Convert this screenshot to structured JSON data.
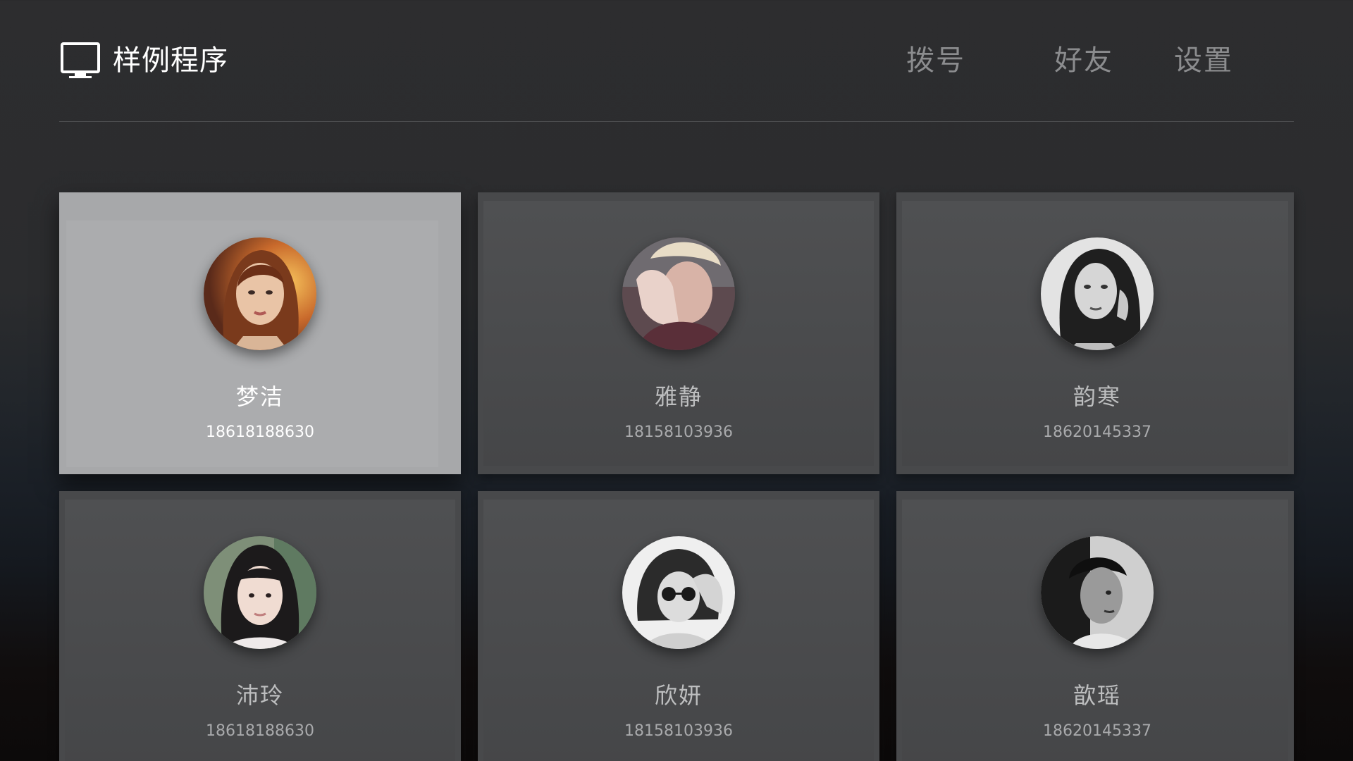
{
  "header": {
    "app_icon": "monitor-icon",
    "title": "样例程序",
    "nav": [
      {
        "label": "拨号"
      },
      {
        "label": "好友"
      },
      {
        "label": "设置"
      }
    ]
  },
  "colors": {
    "focused_card": "#a7a8aa",
    "card": "#48494b",
    "nav_text": "#8b8c8e",
    "title_text": "#ffffff"
  },
  "contacts": [
    {
      "name": "梦洁",
      "phone": "18618188630",
      "focused": true,
      "avatar": "avatar-photo"
    },
    {
      "name": "雅静",
      "phone": "18158103936",
      "focused": false,
      "avatar": "avatar-photo"
    },
    {
      "name": "韵寒",
      "phone": "18620145337",
      "focused": false,
      "avatar": "avatar-photo"
    },
    {
      "name": "沛玲",
      "phone": "18618188630",
      "focused": false,
      "avatar": "avatar-photo"
    },
    {
      "name": "欣妍",
      "phone": "18158103936",
      "focused": false,
      "avatar": "avatar-photo"
    },
    {
      "name": "歆瑶",
      "phone": "18620145337",
      "focused": false,
      "avatar": "avatar-photo"
    }
  ]
}
